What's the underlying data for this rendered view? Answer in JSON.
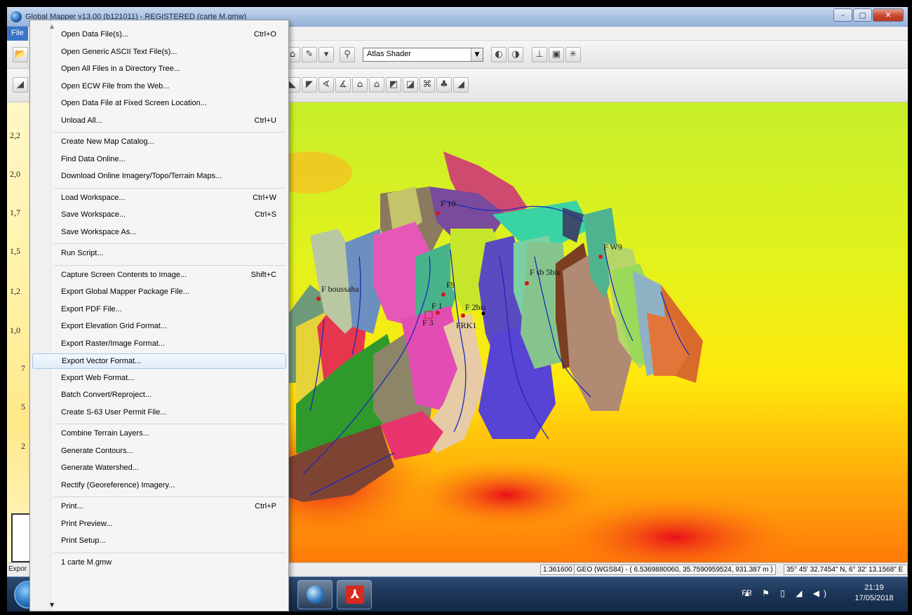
{
  "window": {
    "title": "Global Mapper v13.00 (b121011) - REGISTERED (carte M.gmw)",
    "controls": [
      "–",
      "▢",
      "✕"
    ]
  },
  "menubar": {
    "file": "File"
  },
  "toolbar": {
    "shader_value": "Atlas Shader",
    "shader_arrow": "▼"
  },
  "legend": {
    "labels": [
      "2,2",
      "2,0",
      "1,7",
      "1,5",
      "1,2",
      "1,0",
      "7",
      "5",
      "2"
    ]
  },
  "file_menu": {
    "groups": [
      [
        {
          "label": "Open Data File(s)...",
          "shortcut": "Ctrl+O"
        },
        {
          "label": "Open Generic ASCII Text File(s)...",
          "shortcut": ""
        },
        {
          "label": "Open All Files in a Directory Tree...",
          "shortcut": ""
        },
        {
          "label": "Open ECW File from the Web...",
          "shortcut": ""
        },
        {
          "label": "Open Data File at Fixed Screen Location...",
          "shortcut": ""
        },
        {
          "label": "Unload All...",
          "shortcut": "Ctrl+U"
        }
      ],
      [
        {
          "label": "Create New Map Catalog...",
          "shortcut": ""
        },
        {
          "label": "Find Data Online...",
          "shortcut": ""
        },
        {
          "label": "Download Online Imagery/Topo/Terrain Maps...",
          "shortcut": ""
        }
      ],
      [
        {
          "label": "Load Workspace...",
          "shortcut": "Ctrl+W"
        },
        {
          "label": "Save Workspace...",
          "shortcut": "Ctrl+S"
        },
        {
          "label": "Save Workspace As...",
          "shortcut": ""
        }
      ],
      [
        {
          "label": "Run Script...",
          "shortcut": ""
        }
      ],
      [
        {
          "label": "Capture Screen Contents to Image...",
          "shortcut": "Shift+C"
        },
        {
          "label": "Export Global Mapper Package File...",
          "shortcut": ""
        },
        {
          "label": "Export PDF File...",
          "shortcut": ""
        },
        {
          "label": "Export Elevation Grid Format...",
          "shortcut": ""
        },
        {
          "label": "Export Raster/Image Format...",
          "shortcut": ""
        },
        {
          "label": "Export Vector Format...",
          "shortcut": "",
          "highlighted": true
        },
        {
          "label": "Export Web Format...",
          "shortcut": ""
        },
        {
          "label": "Batch Convert/Reproject...",
          "shortcut": ""
        },
        {
          "label": "Create S-63 User Permit File...",
          "shortcut": ""
        }
      ],
      [
        {
          "label": "Combine Terrain Layers...",
          "shortcut": ""
        },
        {
          "label": "Generate Contours...",
          "shortcut": ""
        },
        {
          "label": "Generate Watershed...",
          "shortcut": ""
        },
        {
          "label": "Rectify (Georeference) Imagery...",
          "shortcut": ""
        }
      ],
      [
        {
          "label": "Print...",
          "shortcut": "Ctrl+P"
        },
        {
          "label": "Print Preview...",
          "shortcut": ""
        },
        {
          "label": "Print Setup...",
          "shortcut": ""
        }
      ],
      [
        {
          "label": "1 carte M.gmw",
          "shortcut": ""
        }
      ]
    ]
  },
  "map": {
    "labels": [
      "F 10",
      "F W9",
      "F sb 5bis",
      "F boussaha",
      "F9",
      "F 1",
      "F 2bis",
      "F 3",
      "FRK1"
    ]
  },
  "statusbar": {
    "left": "Expor",
    "scale": "1:361600",
    "geo": "GEO (WGS84) - ( 6.5369880060, 35.7590959524, 931.387 m )",
    "coord": "35° 45' 32.7454\" N, 6° 32' 13.1568\" E"
  },
  "taskbar": {
    "lang": "FR",
    "time": "21:19",
    "date": "17/05/2018",
    "pdf_glyph": "⅄"
  }
}
